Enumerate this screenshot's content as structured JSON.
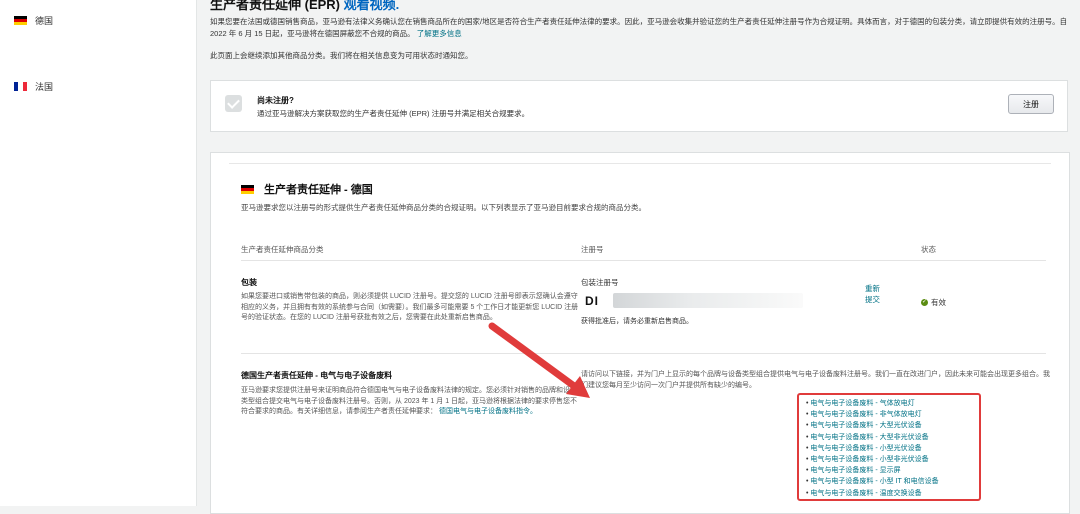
{
  "sidebar": {
    "items": [
      {
        "label": "德国",
        "flag": "de"
      },
      {
        "label": "法国",
        "flag": "fr"
      }
    ]
  },
  "header": {
    "title": "生产者责任延伸 (EPR)",
    "title_link": "观看视频.",
    "intro": "如果您要在法国或德国销售商品，亚马逊有法律义务确认您在销售商品所在的国家/地区是否符合生产者责任延伸法律的要求。因此，亚马逊会收集并验证您的生产者责任延伸注册号作为合规证明。具体而言，对于德国的包装分类，请立即提供有效的注册号。自 2022 年 6 月 15 日起，亚马逊将在德国屏蔽您不合规的商品。",
    "intro_link": "了解更多信息",
    "note": "此页面上会继续添加其他商品分类。我们将在相关信息变为可用状态时通知您。"
  },
  "register_box": {
    "title": "尚未注册?",
    "description": "通过亚马逊解决方案获取您的生产者责任延伸 (EPR) 注册号并满足相关合规要求。",
    "button": "注册"
  },
  "card": {
    "title": "生产者责任延伸 - 德国",
    "subtitle": "亚马逊要求您以注册号的形式提供生产者责任延伸商品分类的合规证明。以下列表显示了亚马逊目前要求合规的商品分类。",
    "columns": [
      "生产者责任延伸商品分类",
      "注册号",
      "状态"
    ],
    "packaging": {
      "name": "包装",
      "description": "如果您要进口或销售带包装的商品，则必须提供 LUCID 注册号。提交您的 LUCID 注册号即表示您确认会遵守相应的义务，并且拥有有效的系统参与合同（如需要）。我们最多可能需要 5 个工作日才能更新您 LUCID 注册号的验证状态。在您的 LUCID 注册号获批有效之后，您需要在此处重新启售商品。",
      "reg_label": "包装注册号",
      "reg_value": "DI",
      "hint": "获得批准后，请务必重新启售商品。",
      "resubmit": "重新提交",
      "status": "有效"
    },
    "eee": {
      "name": "德国生产者责任延伸 - 电气与电子设备废料",
      "description": "亚马逊要求您提供注册号来证明商品符合德国电气与电子设备废料法律的规定。您必须针对销售的品牌和设备类型组合提交电气与电子设备废料注册号。否则，从 2023 年 1 月 1 日起，亚马逊将根据法律的要求停售您不符合要求的商品。有关详细信息，请参阅生产者责任延伸要求：",
      "link": "德国电气与电子设备废料指令。",
      "info": "请访问以下链接，并为门户上显示的每个品牌与设备类型组合提供电气与电子设备废料注册号。我们一直在改进门户，因此未来可能会出现更多组合。我们建议您每月至少访问一次门户并提供所有缺少的编号。",
      "items": [
        "电气与电子设备废料 - 气体放电灯",
        "电气与电子设备废料 - 非气体放电灯",
        "电气与电子设备废料 - 大型光伏设备",
        "电气与电子设备废料 - 大型非光伏设备",
        "电气与电子设备废料 - 小型光伏设备",
        "电气与电子设备废料 - 小型非光伏设备",
        "电气与电子设备废料 - 显示屏",
        "电气与电子设备废料 - 小型 IT 和电信设备",
        "电气与电子设备废料 - 温度交换设备"
      ]
    }
  },
  "colors": {
    "link": "#007185",
    "annotation": "#e03b3b",
    "status_ok": "#5b8d12"
  }
}
